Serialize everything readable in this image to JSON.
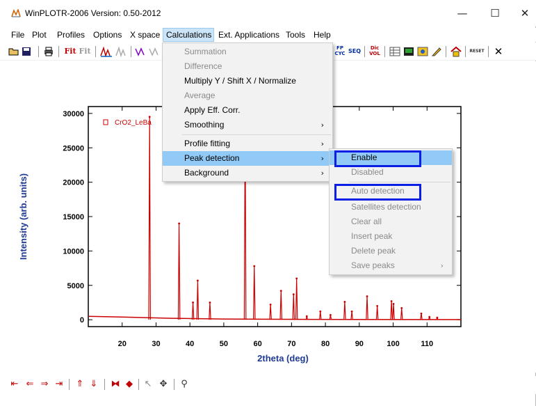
{
  "window": {
    "title": "WinPLOTR-2006 Version: 0.50-2012",
    "minimize": "—",
    "maximize": "☐",
    "close": "✕"
  },
  "menubar": [
    "File",
    "Plot",
    "Profiles",
    "Options",
    "X space",
    "Calculations",
    "Ext. Applications",
    "Tools",
    "Help"
  ],
  "toolbar": {
    "fit": "Fit",
    "fit2": "Fit",
    "cyc": "FP CYC",
    "seq": "SEQ",
    "dic": "Dic VOL",
    "reset": "RESET",
    "close": "✕"
  },
  "calculations_menu": {
    "items": [
      {
        "label": "Summation",
        "disabled": true
      },
      {
        "label": "Difference",
        "disabled": true
      },
      {
        "label": "Multiply Y / Shift X / Normalize",
        "disabled": false
      },
      {
        "label": "Average",
        "disabled": true
      },
      {
        "label": "Apply Eff. Corr.",
        "disabled": false
      },
      {
        "label": "Smoothing",
        "disabled": false,
        "submenu": true
      },
      {
        "label": "Profile fitting",
        "disabled": false,
        "submenu": true
      },
      {
        "label": "Peak detection",
        "disabled": false,
        "submenu": true,
        "highlighted": true
      },
      {
        "label": "Background",
        "disabled": false,
        "submenu": true
      }
    ]
  },
  "peak_menu": {
    "items": [
      {
        "label": "Enable",
        "disabled": false,
        "highlighted": true
      },
      {
        "label": "Disabled",
        "disabled": true
      },
      {
        "label": "Auto detection",
        "disabled": true
      },
      {
        "label": "Satellites detection",
        "disabled": true
      },
      {
        "label": "Clear all",
        "disabled": true
      },
      {
        "label": "Insert peak",
        "disabled": true
      },
      {
        "label": "Delete peak",
        "disabled": true
      },
      {
        "label": "Save peaks",
        "disabled": true,
        "submenu": true
      }
    ]
  },
  "chart_data": {
    "type": "line",
    "title": "",
    "legend": "CrO2_LeBa",
    "xlabel": "2theta (deg)",
    "ylabel": "Intensity (arb. units)",
    "xlim": [
      10,
      120
    ],
    "ylim": [
      -1000,
      31000
    ],
    "xticks": [
      20,
      30,
      40,
      50,
      60,
      70,
      80,
      90,
      100,
      110
    ],
    "yticks": [
      0,
      5000,
      10000,
      15000,
      20000,
      25000,
      30000
    ],
    "color": "#cc0000",
    "background": {
      "x": [
        10,
        15,
        20,
        25,
        28,
        35,
        50,
        75,
        120
      ],
      "y": [
        500,
        450,
        400,
        330,
        300,
        200,
        100,
        50,
        20
      ]
    },
    "peaks": [
      {
        "x": 28.1,
        "y": 29500
      },
      {
        "x": 36.8,
        "y": 14000
      },
      {
        "x": 40.9,
        "y": 2500
      },
      {
        "x": 42.3,
        "y": 5700
      },
      {
        "x": 45.9,
        "y": 2500
      },
      {
        "x": 56.3,
        "y": 30000
      },
      {
        "x": 59.0,
        "y": 7800
      },
      {
        "x": 63.8,
        "y": 2200
      },
      {
        "x": 66.9,
        "y": 4200
      },
      {
        "x": 70.6,
        "y": 3700
      },
      {
        "x": 71.5,
        "y": 6000
      },
      {
        "x": 74.5,
        "y": 500
      },
      {
        "x": 78.5,
        "y": 1200
      },
      {
        "x": 81.5,
        "y": 700
      },
      {
        "x": 85.7,
        "y": 2600
      },
      {
        "x": 87.8,
        "y": 1200
      },
      {
        "x": 92.3,
        "y": 3400
      },
      {
        "x": 95.3,
        "y": 2000
      },
      {
        "x": 99.5,
        "y": 2700
      },
      {
        "x": 100.1,
        "y": 2300
      },
      {
        "x": 102.5,
        "y": 1700
      },
      {
        "x": 108.3,
        "y": 900
      },
      {
        "x": 110.7,
        "y": 400
      },
      {
        "x": 113.0,
        "y": 300
      }
    ],
    "grid": false
  },
  "bottom_toolbar": {
    "first": "⇤",
    "prev": "⇐",
    "next": "⇒",
    "last": "⇥",
    "up": "⇑",
    "down": "⇓",
    "expand": "⧓",
    "shrink": "◆",
    "pointer": "↖",
    "move": "✥",
    "zoom": "⚲"
  }
}
